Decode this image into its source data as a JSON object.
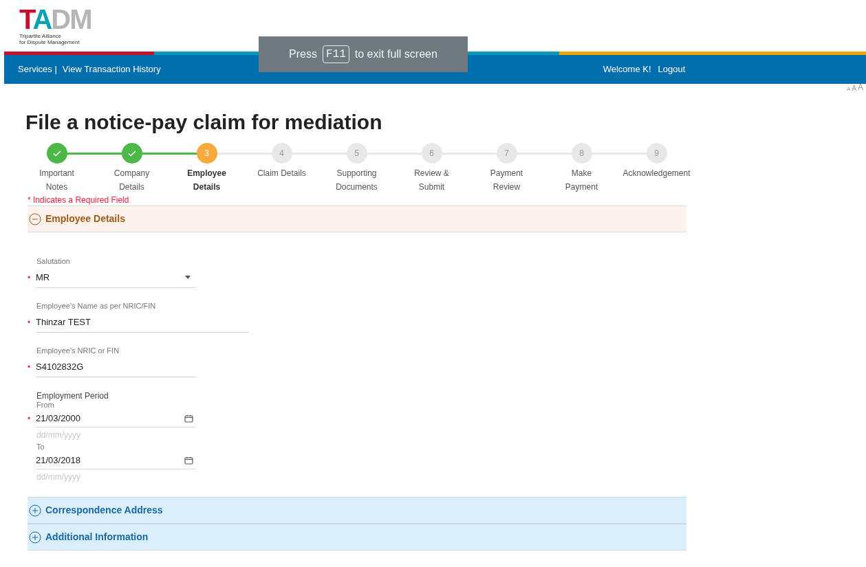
{
  "logo": {
    "letters": "TADM",
    "tagline": [
      "Tripartite Alliance",
      "for Dispute Management"
    ]
  },
  "fullscreen_notice": {
    "before": "Press",
    "key": "F11",
    "after": "to exit full screen"
  },
  "nav": {
    "links": [
      {
        "label": "Services |"
      },
      {
        "label": "View Transaction History"
      }
    ],
    "welcome": "Welcome K!",
    "logout": "Logout"
  },
  "font_size_controls": [
    "A",
    "A",
    "A"
  ],
  "title": "File a notice-pay claim for mediation",
  "steps": [
    {
      "label": [
        "Important",
        "Notes"
      ],
      "completed": true,
      "selected": false
    },
    {
      "label": [
        "Company",
        "Details"
      ],
      "completed": true,
      "selected": false
    },
    {
      "marker": "3",
      "label": [
        "Employee",
        "Details"
      ],
      "completed": false,
      "selected": true
    },
    {
      "marker": "4",
      "label": [
        "Claim Details"
      ],
      "completed": false,
      "selected": false
    },
    {
      "marker": "5",
      "label": [
        "Supporting",
        "Documents"
      ],
      "completed": false,
      "selected": false
    },
    {
      "marker": "6",
      "label": [
        "Review &",
        "Submit"
      ],
      "completed": false,
      "selected": false
    },
    {
      "marker": "7",
      "label": [
        "Payment",
        "Review"
      ],
      "completed": false,
      "selected": false
    },
    {
      "marker": "8",
      "label": [
        "Make",
        "Payment"
      ],
      "completed": false,
      "selected": false
    },
    {
      "marker": "9",
      "label": [
        "Acknowledgement"
      ],
      "completed": false,
      "selected": false
    }
  ],
  "required_note": "* Indicates a Required Field",
  "sections": [
    {
      "title": "Employee Details",
      "expanded": true
    },
    {
      "title": "Correspondence Address",
      "expanded": false
    },
    {
      "title": "Additional Information",
      "expanded": false
    }
  ],
  "fields": [
    {
      "kind": "select",
      "label": "Salutation",
      "value": "MR",
      "required_mark": "•",
      "wide": false
    },
    {
      "kind": "text",
      "label": "Employee's Name as per NRIC/FIN",
      "value": "Thinzar TEST",
      "required_mark": "•",
      "wide": true
    },
    {
      "kind": "text",
      "label": "Employee's NRIC or FIN",
      "value": "S4102832G",
      "required_mark": "•",
      "wide": false
    },
    {
      "kind": "period",
      "label": "Employment Period",
      "parts": [
        {
          "label": "From",
          "value": "21/03/2000",
          "hint": "dd/mm/yyyy",
          "required_mark": "•"
        },
        {
          "label": "To",
          "value": "21/03/2018",
          "hint": "dd/mm/yyyy"
        }
      ]
    }
  ]
}
